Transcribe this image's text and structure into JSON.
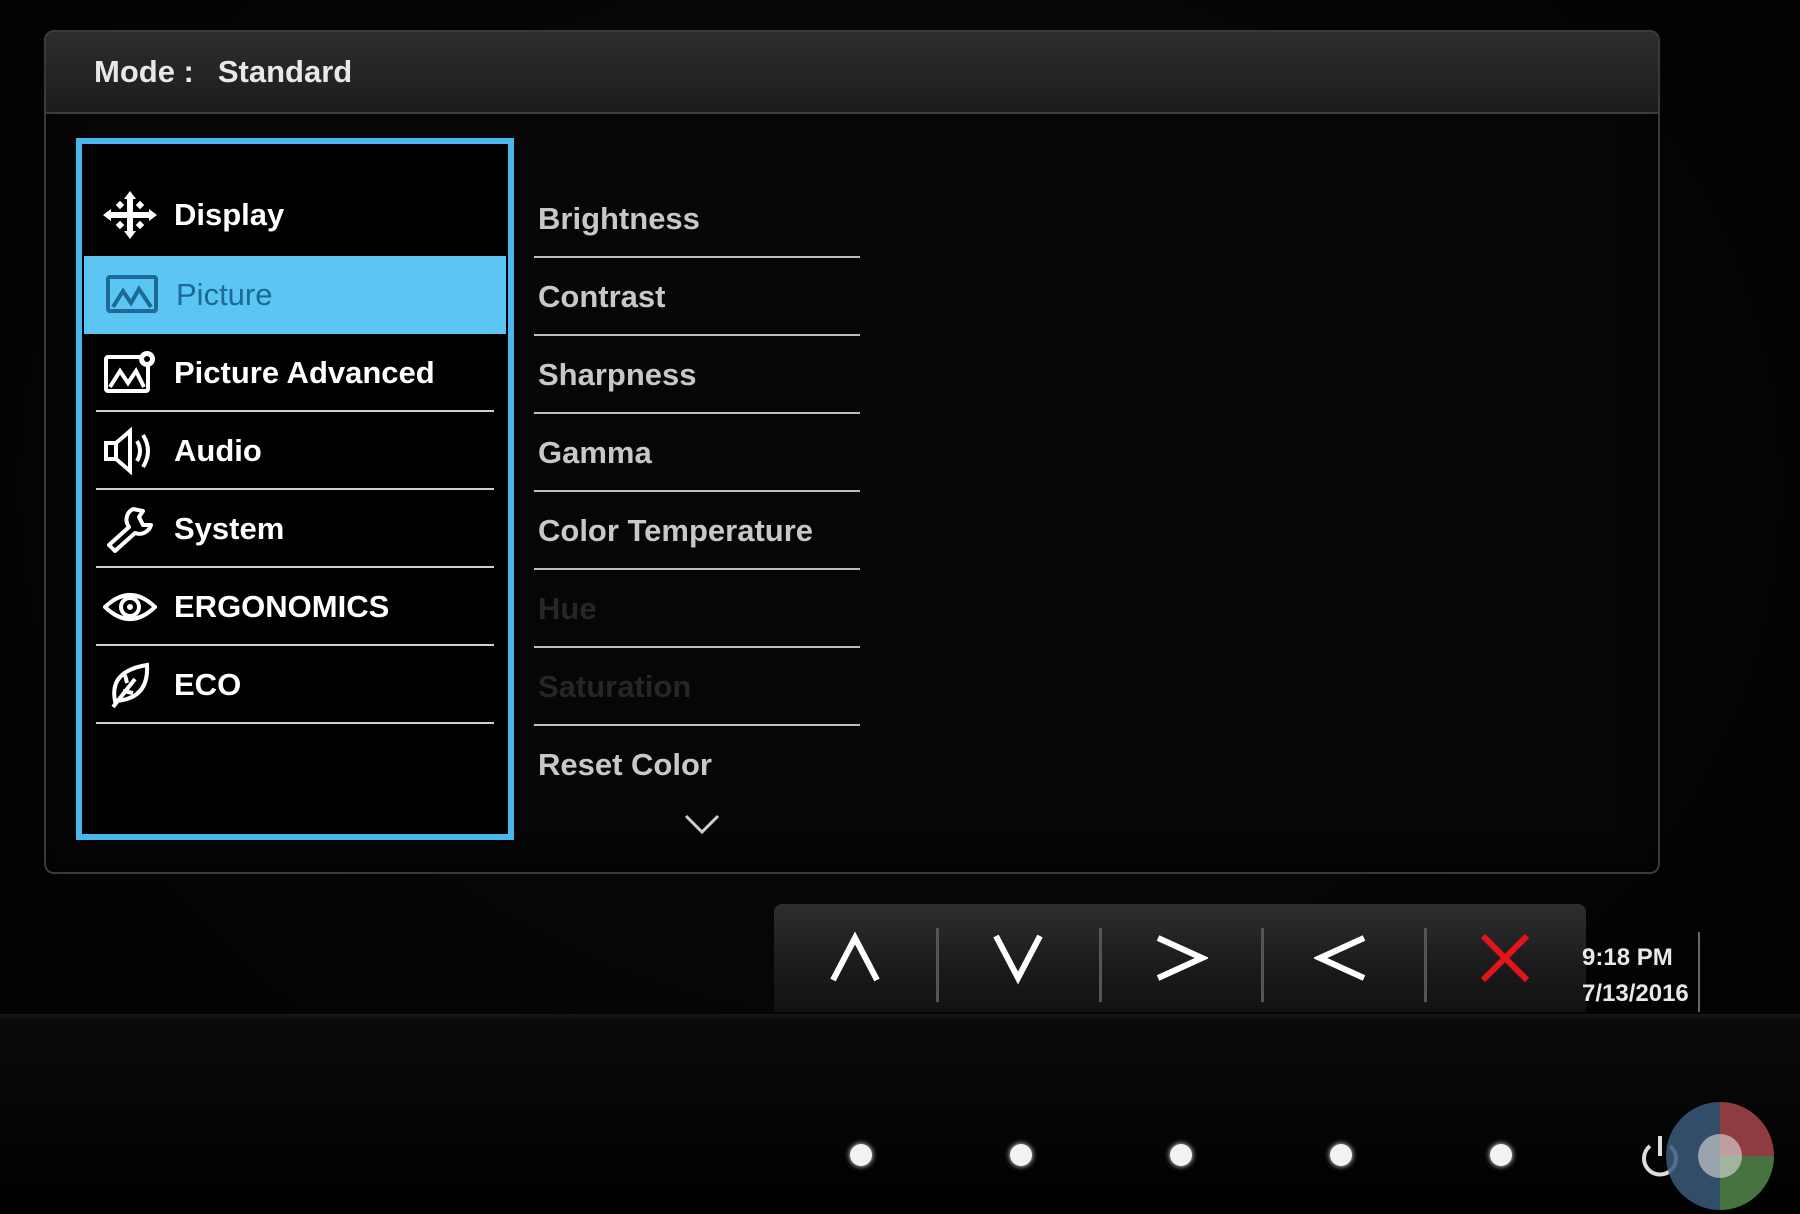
{
  "header": {
    "mode_label": "Mode :",
    "mode_value": "Standard"
  },
  "categories": [
    {
      "label": "Display",
      "icon": "display-icon",
      "selected": false
    },
    {
      "label": "Picture",
      "icon": "picture-icon",
      "selected": true
    },
    {
      "label": "Picture Advanced",
      "icon": "picture-advanced-icon",
      "selected": false
    },
    {
      "label": "Audio",
      "icon": "speaker-icon",
      "selected": false
    },
    {
      "label": "System",
      "icon": "wrench-icon",
      "selected": false
    },
    {
      "label": "ERGONOMICS",
      "icon": "eye-icon",
      "selected": false
    },
    {
      "label": "ECO",
      "icon": "leaf-icon",
      "selected": false
    }
  ],
  "submenu": [
    {
      "label": "Brightness",
      "enabled": true
    },
    {
      "label": "Contrast",
      "enabled": true
    },
    {
      "label": "Sharpness",
      "enabled": true
    },
    {
      "label": "Gamma",
      "enabled": true
    },
    {
      "label": "Color Temperature",
      "enabled": true
    },
    {
      "label": "Hue",
      "enabled": false
    },
    {
      "label": "Saturation",
      "enabled": false
    },
    {
      "label": "Reset Color",
      "enabled": true
    }
  ],
  "keys": [
    "up-arrow-icon",
    "down-arrow-icon",
    "right-arrow-icon",
    "left-arrow-icon",
    "close-x-icon"
  ],
  "colors": {
    "accent": "#4ab6ee",
    "selected_bg": "#5bc6f4",
    "close": "#e2141c"
  },
  "clock": {
    "time": "9:18 PM",
    "date": "7/13/2016"
  }
}
